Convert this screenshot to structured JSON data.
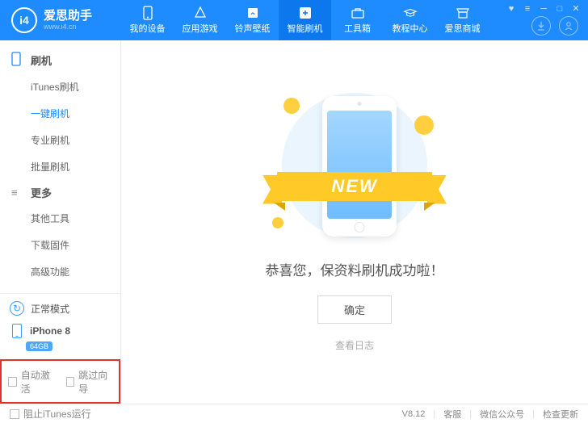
{
  "brand": {
    "name": "爱思助手",
    "site": "www.i4.cn",
    "logo_text": "i4"
  },
  "nav": {
    "items": [
      {
        "label": "我的设备",
        "icon": "device"
      },
      {
        "label": "应用游戏",
        "icon": "apps"
      },
      {
        "label": "铃声壁纸",
        "icon": "ringtone"
      },
      {
        "label": "智能刷机",
        "icon": "flash"
      },
      {
        "label": "工具箱",
        "icon": "toolbox"
      },
      {
        "label": "教程中心",
        "icon": "tutorial"
      },
      {
        "label": "爱思商城",
        "icon": "store"
      }
    ],
    "active_index": 3
  },
  "sidebar": {
    "sections": [
      {
        "title": "刷机",
        "items": [
          "iTunes刷机",
          "一键刷机",
          "专业刷机",
          "批量刷机"
        ],
        "active_index": 1
      },
      {
        "title": "更多",
        "items": [
          "其他工具",
          "下载固件",
          "高级功能"
        ],
        "active_index": -1
      }
    ],
    "status_mode": "正常模式",
    "device_name": "iPhone 8",
    "device_storage": "64GB",
    "auto_activate": "自动激活",
    "skip_wizard": "跳过向导"
  },
  "main": {
    "ribbon_text": "NEW",
    "message": "恭喜您，保资料刷机成功啦！",
    "ok_button": "确定",
    "view_log": "查看日志"
  },
  "footer": {
    "block_itunes": "阻止iTunes运行",
    "version": "V8.12",
    "support": "客服",
    "wechat": "微信公众号",
    "check_update": "检查更新"
  }
}
